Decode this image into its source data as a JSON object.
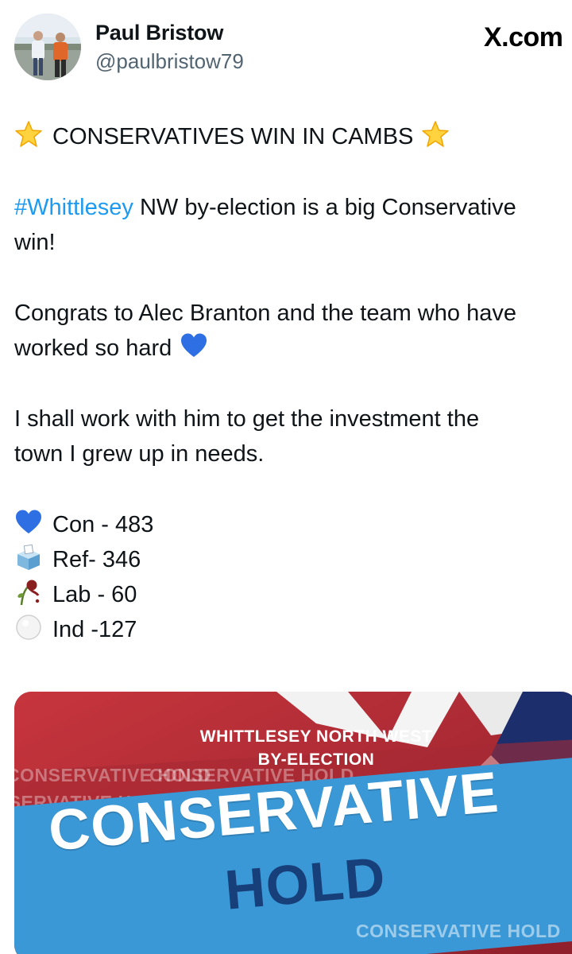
{
  "header": {
    "display_name": "Paul Bristow",
    "handle": "@paulbristow79",
    "brand": "X.com"
  },
  "tweet": {
    "title": "CONSERVATIVES WIN IN CAMBS",
    "para1": {
      "hashtag": "#Whittlesey",
      "line1_rest": " NW by-election is a big Conservative",
      "line2": "win!"
    },
    "para2": {
      "line1": "Congrats to Alec Branton and the team who have",
      "line2": "worked so hard"
    },
    "para3": {
      "line1": "I shall work with him to get the investment the",
      "line2": "town I grew up in needs."
    },
    "results": [
      {
        "icon": "blue-heart-icon",
        "text": "Con - 483"
      },
      {
        "icon": "ballot-box-icon",
        "text": "Ref- 346"
      },
      {
        "icon": "wilted-rose-icon",
        "text": "Lab - 60"
      },
      {
        "icon": "white-circle-icon",
        "text": "Ind -127"
      }
    ]
  },
  "image": {
    "subtitle_line1": "WHITTLESEY NORTH WEST",
    "subtitle_line2": "BY-ELECTION",
    "ticker": "CONSERVATIVE HOLD",
    "headline_line1": "CONSERVATIVE",
    "headline_line2": "HOLD"
  },
  "colors": {
    "hashtag": "#1d9bf0",
    "handle": "#536471",
    "banner_blue": "#3a98d6",
    "headline_navy": "#173f7a",
    "flag_red": "#b12b35"
  }
}
